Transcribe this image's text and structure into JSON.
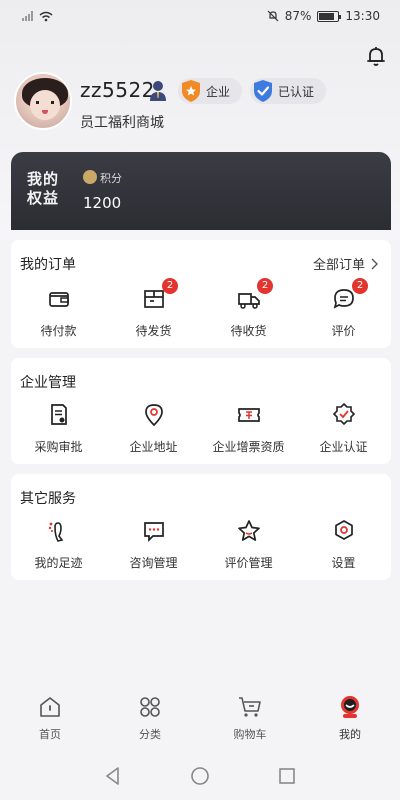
{
  "status_bar": {
    "battery": "87%",
    "time": "13:30"
  },
  "profile": {
    "username": "zz5522",
    "badges": [
      {
        "label": "企业"
      },
      {
        "label": "已认证"
      }
    ],
    "subtitle": "员工福利商城"
  },
  "rights": {
    "title": "我的权益",
    "points_label": "积分",
    "points_value": "1200"
  },
  "orders": {
    "title": "我的订单",
    "more_label": "全部订单",
    "items": [
      {
        "label": "待付款",
        "icon": "wallet-icon"
      },
      {
        "label": "待发货",
        "icon": "package-icon",
        "count": "2"
      },
      {
        "label": "待收货",
        "icon": "truck-icon",
        "count": "2"
      },
      {
        "label": "评价",
        "icon": "chat-icon",
        "count": "2"
      }
    ]
  },
  "enterprise": {
    "title": "企业管理",
    "items": [
      {
        "label": "采购审批",
        "icon": "approval-doc-icon"
      },
      {
        "label": "企业地址",
        "icon": "location-pin-icon"
      },
      {
        "label": "企业增票资质",
        "icon": "ticket-icon"
      },
      {
        "label": "企业认证",
        "icon": "certified-badge-icon"
      }
    ]
  },
  "services": {
    "title": "其它服务",
    "items": [
      {
        "label": "我的足迹",
        "icon": "footprint-icon"
      },
      {
        "label": "咨询管理",
        "icon": "consult-icon"
      },
      {
        "label": "评价管理",
        "icon": "star-icon"
      },
      {
        "label": "设置",
        "icon": "settings-icon"
      }
    ]
  },
  "bottom_nav": [
    {
      "label": "首页",
      "icon": "home-icon"
    },
    {
      "label": "分类",
      "icon": "category-icon"
    },
    {
      "label": "购物车",
      "icon": "cart-icon"
    },
    {
      "label": "我的",
      "icon": "profile-icon",
      "active": true
    }
  ],
  "colors": {
    "accent": "#e3342f",
    "card_dark": "#2f3036",
    "gold": "#c9a868"
  }
}
